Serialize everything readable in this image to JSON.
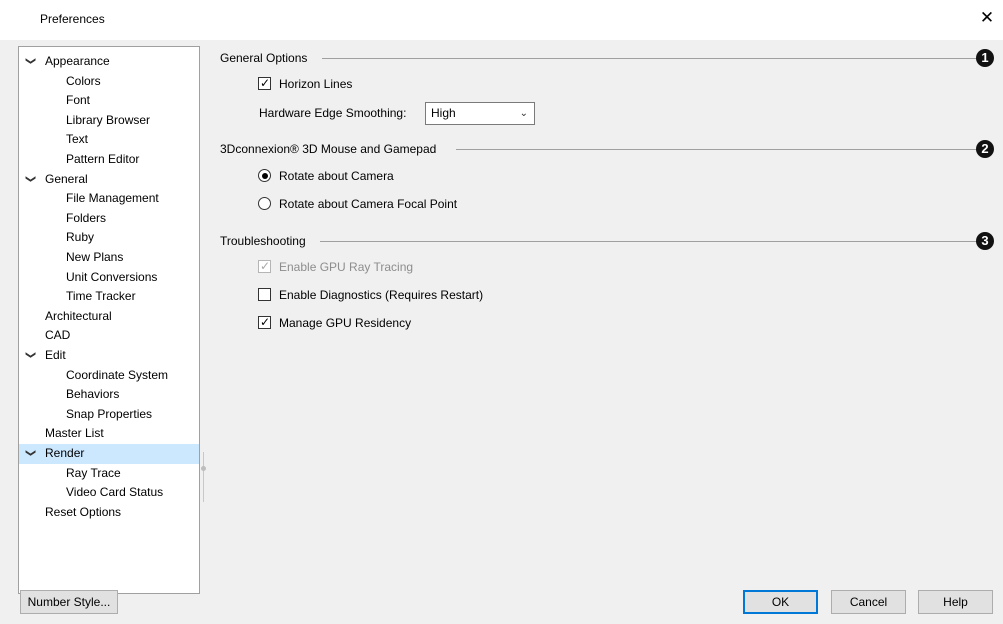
{
  "window": {
    "title": "Preferences",
    "close_glyph": "✕"
  },
  "tree": {
    "items": [
      {
        "label": "Appearance",
        "level": 0,
        "expanded": true
      },
      {
        "label": "Colors",
        "level": 1
      },
      {
        "label": "Font",
        "level": 1
      },
      {
        "label": "Library Browser",
        "level": 1
      },
      {
        "label": "Text",
        "level": 1
      },
      {
        "label": "Pattern Editor",
        "level": 1
      },
      {
        "label": "General",
        "level": 0,
        "expanded": true
      },
      {
        "label": "File Management",
        "level": 1
      },
      {
        "label": "Folders",
        "level": 1
      },
      {
        "label": "Ruby",
        "level": 1
      },
      {
        "label": "New Plans",
        "level": 1
      },
      {
        "label": "Unit Conversions",
        "level": 1
      },
      {
        "label": "Time Tracker",
        "level": 1
      },
      {
        "label": "Architectural",
        "level": 0
      },
      {
        "label": "CAD",
        "level": 0
      },
      {
        "label": "Edit",
        "level": 0,
        "expanded": true
      },
      {
        "label": "Coordinate System",
        "level": 1
      },
      {
        "label": "Behaviors",
        "level": 1
      },
      {
        "label": "Snap Properties",
        "level": 1
      },
      {
        "label": "Master List",
        "level": 0
      },
      {
        "label": "Render",
        "level": 0,
        "expanded": true,
        "selected": true
      },
      {
        "label": "Ray Trace",
        "level": 1
      },
      {
        "label": "Video Card Status",
        "level": 1
      },
      {
        "label": "Reset Options",
        "level": 0
      }
    ],
    "chevron_glyph": "❯"
  },
  "general_options": {
    "title": "General Options",
    "badge": "1",
    "horizon_lines_label": "Horizon Lines",
    "horizon_lines_checked": true,
    "edge_smoothing_label": "Hardware Edge Smoothing:",
    "edge_smoothing_value": "High"
  },
  "mouse": {
    "title": "3Dconnexion® 3D Mouse and Gamepad",
    "badge": "2",
    "options": [
      {
        "label": "Rotate about Camera",
        "selected": true
      },
      {
        "label": "Rotate about Camera Focal Point",
        "selected": false
      }
    ]
  },
  "troubleshooting": {
    "title": "Troubleshooting",
    "badge": "3",
    "options": [
      {
        "label": "Enable GPU Ray Tracing",
        "checked": true,
        "disabled": true
      },
      {
        "label": "Enable Diagnostics (Requires Restart)",
        "checked": false,
        "disabled": false
      },
      {
        "label": "Manage GPU Residency",
        "checked": true,
        "disabled": false
      }
    ]
  },
  "buttons": {
    "number_style": "Number Style...",
    "ok": "OK",
    "cancel": "Cancel",
    "help": "Help"
  },
  "glyphs": {
    "check": "✓",
    "dropdown": "⌄"
  },
  "colors": {
    "selection": "#cce8ff",
    "default_button_border": "#0078d7"
  }
}
